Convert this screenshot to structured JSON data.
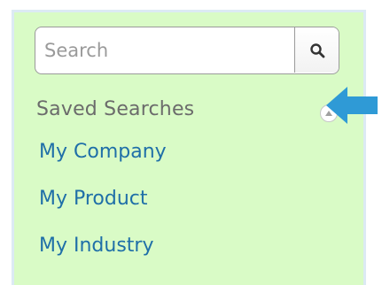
{
  "search": {
    "placeholder": "Search",
    "value": "",
    "button_icon": "magnifier-icon"
  },
  "saved_searches": {
    "title": "Saved Searches",
    "toggle_icon": "collapse-up-icon",
    "items": [
      {
        "label": "My Company"
      },
      {
        "label": "My Product"
      },
      {
        "label": "My Industry"
      }
    ]
  },
  "annotation": {
    "arrow_icon": "blue-arrow-pointer-icon",
    "arrow_color": "#2f9ad6"
  },
  "colors": {
    "panel_bg": "#d9fbc6",
    "panel_border": "#dceaf4",
    "link": "#1f6fa8",
    "heading": "#6b6b6b"
  }
}
